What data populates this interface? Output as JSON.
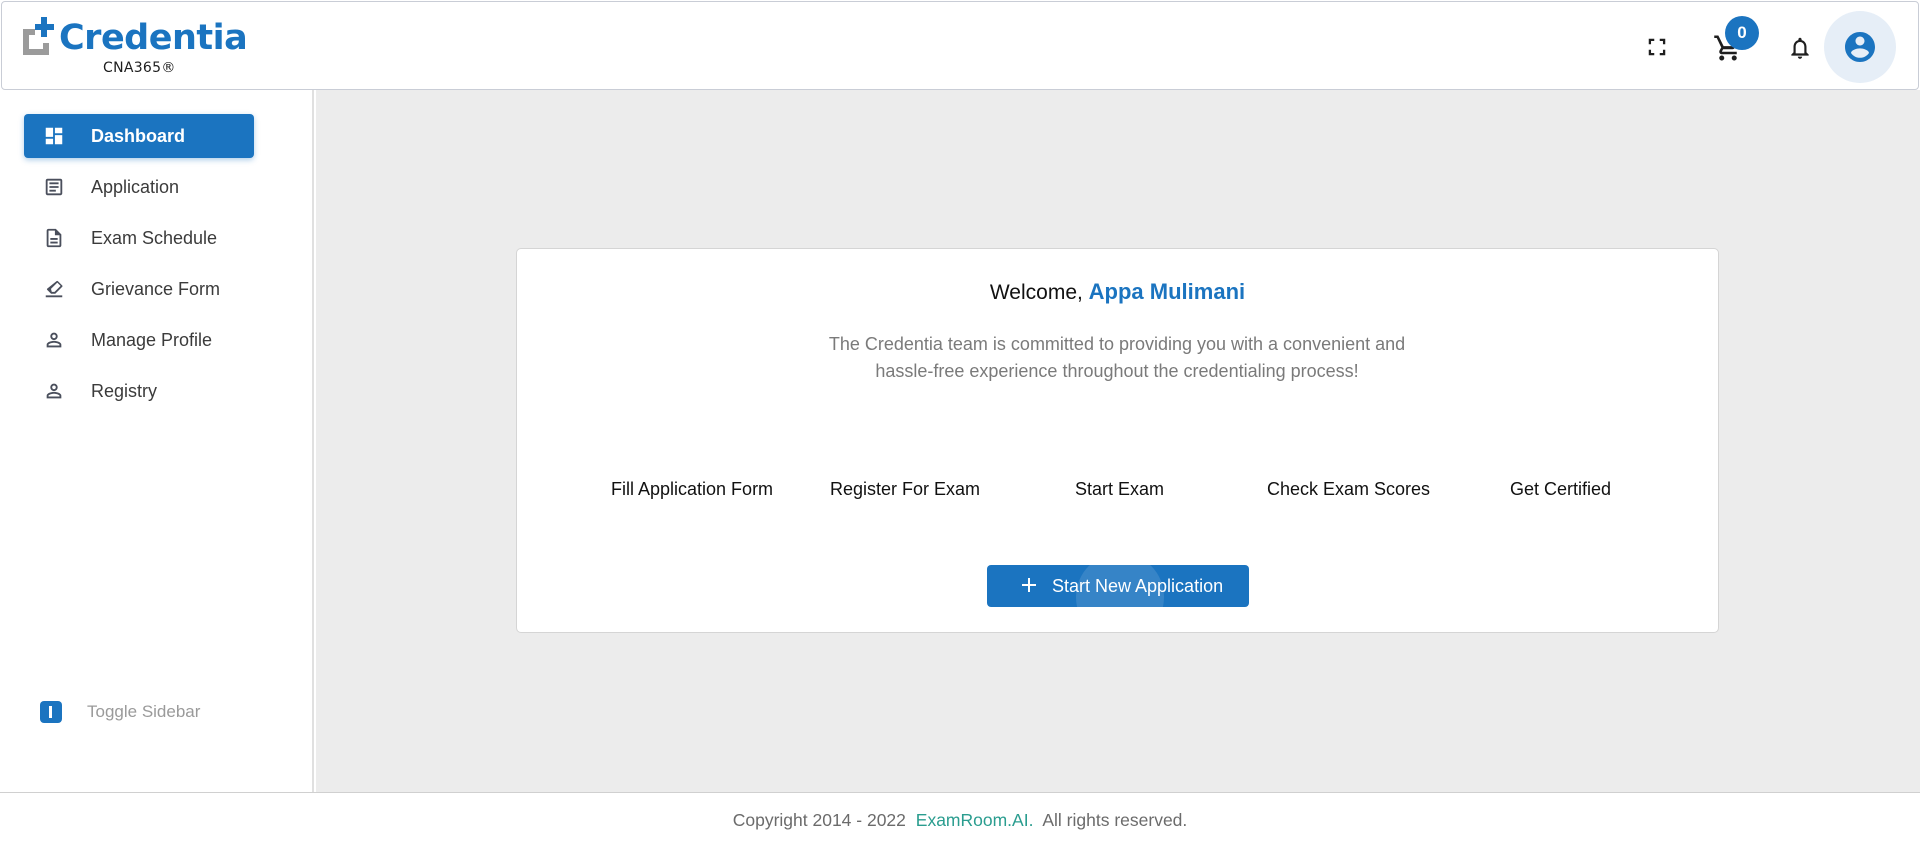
{
  "brand": {
    "name": "Credentia",
    "product": "CNA365®",
    "colors": {
      "primary": "#1b74c0",
      "logo_gray": "#9b9b9b",
      "link": "#2a9d8f"
    }
  },
  "header": {
    "icons": [
      "fullscreen-icon",
      "cart-icon",
      "bell-icon",
      "account-circle-icon"
    ],
    "cart_count": "0"
  },
  "sidebar": {
    "items": [
      {
        "label": "Dashboard",
        "icon": "dashboard-icon",
        "active": true
      },
      {
        "label": "Application",
        "icon": "document-list-icon",
        "active": false
      },
      {
        "label": "Exam Schedule",
        "icon": "file-icon",
        "active": false
      },
      {
        "label": "Grievance Form",
        "icon": "eraser-icon",
        "active": false
      },
      {
        "label": "Manage Profile",
        "icon": "person-icon",
        "active": false
      },
      {
        "label": "Registry",
        "icon": "person-icon",
        "active": false
      }
    ],
    "toggle_label": "Toggle Sidebar"
  },
  "main": {
    "welcome_prefix": "Welcome, ",
    "user_name": "Appa Mulimani",
    "intro_line1": "The Credentia team is committed to providing you with a convenient and",
    "intro_line2": "hassle-free experience throughout the credentialing process!",
    "steps": [
      "Fill Application Form",
      "Register For Exam",
      "Start Exam",
      "Check Exam Scores",
      "Get Certified"
    ],
    "start_button": "Start New Application"
  },
  "footer": {
    "copyright": "Copyright 2014 - 2022",
    "company_link": "ExamRoom.AI.",
    "rights": "All rights reserved."
  }
}
